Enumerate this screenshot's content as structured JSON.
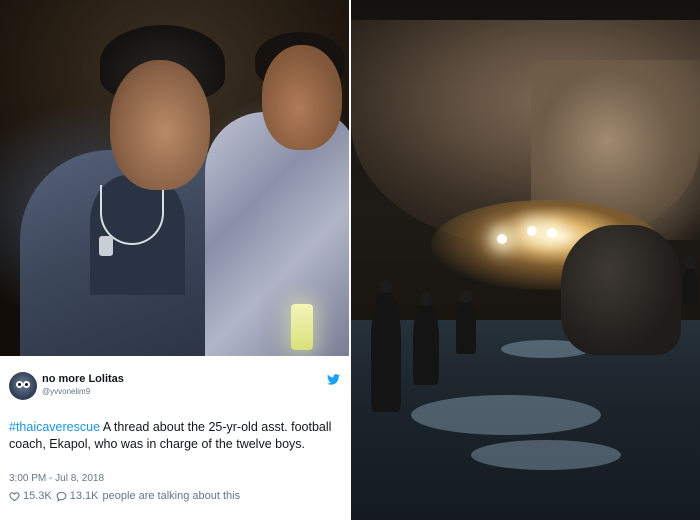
{
  "tweet": {
    "display_name": "no more Lolitas",
    "handle": "@yvvonelim9",
    "hashtag": "#thaicaverescue",
    "text": " A thread about the 25-yr-old asst. football coach, Ekapol, who was in charge of the twelve boys.",
    "timestamp": "3:00 PM - Jul 8, 2018",
    "likes": "15.3K",
    "replies": "13.1K",
    "talking_suffix": "people are talking about this",
    "avatar_icon": "cookie-monster-avatar",
    "brand_icon": "twitter-bird-icon",
    "like_icon": "heart-outline-icon",
    "reply_icon": "speech-bubble-icon",
    "colors": {
      "hashtag": "#1b95e0",
      "brand": "#1da1f2",
      "muted": "#657786",
      "text": "#14171a"
    }
  },
  "photos": {
    "left": "photo-boys-in-cave",
    "right": "photo-cave-rescue"
  }
}
